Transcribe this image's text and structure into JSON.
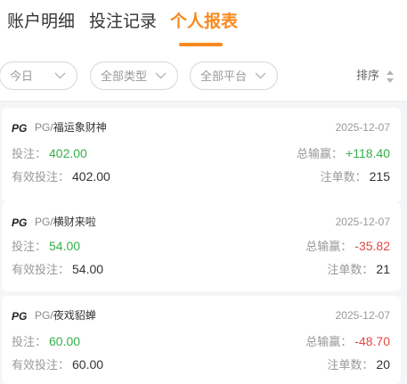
{
  "tabs": [
    "账户明细",
    "投注记录",
    "个人报表"
  ],
  "active_tab": "个人报表",
  "accent_color": "#f7891f",
  "filters": {
    "date": "今日",
    "type": "全部类型",
    "platform": "全部平台",
    "sort": "排序"
  },
  "labels": {
    "bet": "投注：",
    "valid_bet": "有效投注：",
    "win_loss": "总输赢：",
    "count": "注单数："
  },
  "records": [
    {
      "provider": "PG",
      "game": "福运象财神",
      "date": "2025-12-07",
      "bet": "402.00",
      "valid_bet": "402.00",
      "win_loss": "+118.40",
      "count": "215"
    },
    {
      "provider": "PG",
      "game": "横财来啦",
      "date": "2025-12-07",
      "bet": "54.00",
      "valid_bet": "54.00",
      "win_loss": "-35.82",
      "count": "21"
    },
    {
      "provider": "PG",
      "game": "夜戏貂蝉",
      "date": "2025-12-07",
      "bet": "60.00",
      "valid_bet": "60.00",
      "win_loss": "-48.70",
      "count": "20"
    }
  ],
  "colors": {
    "positive": "#36b04a",
    "negative": "#e04848"
  }
}
